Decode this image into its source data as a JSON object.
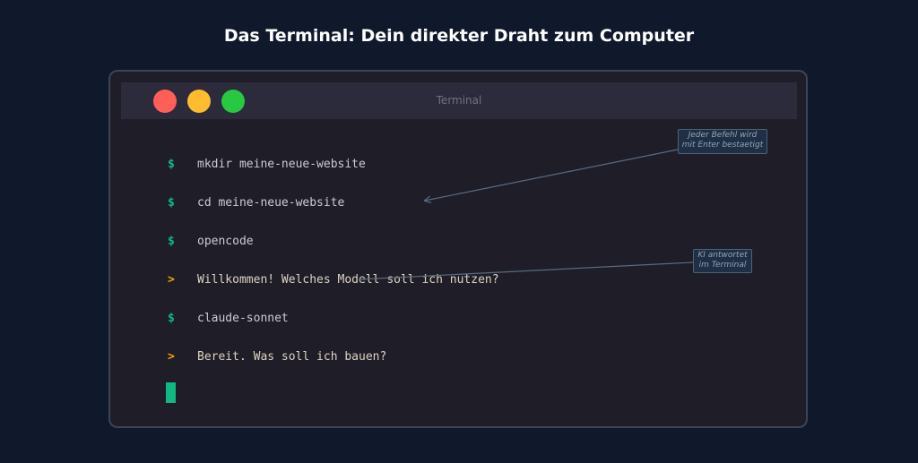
{
  "page": {
    "title": "Das Terminal: Dein direkter Draht zum Computer"
  },
  "terminal": {
    "window_title": "Terminal",
    "lines": [
      {
        "prompt": "$",
        "kind": "command",
        "text": "mkdir meine-neue-website"
      },
      {
        "prompt": "$",
        "kind": "command",
        "text": "cd meine-neue-website"
      },
      {
        "prompt": "$",
        "kind": "command",
        "text": "opencode"
      },
      {
        "prompt": ">",
        "kind": "response",
        "text": "Willkommen! Welches Modell soll ich nutzen?"
      },
      {
        "prompt": "$",
        "kind": "command",
        "text": "claude-sonnet"
      },
      {
        "prompt": ">",
        "kind": "response",
        "text": "Bereit. Was soll ich bauen?"
      }
    ]
  },
  "annotations": [
    {
      "lines": [
        "Jeder Befehl wird",
        "mit Enter bestaetigt"
      ]
    },
    {
      "lines": [
        "KI antwortet",
        "im Terminal"
      ]
    }
  ],
  "colors": {
    "background": "#10192b",
    "command_prompt": "#10b981",
    "response_prompt": "#f59e0b",
    "close_button": "#ff5f57",
    "minimize_button": "#febc2e",
    "maximize_button": "#28c840",
    "cursor": "#10b981"
  }
}
